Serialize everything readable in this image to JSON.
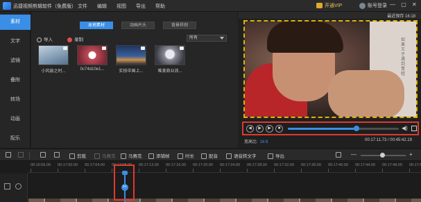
{
  "app": {
    "title": "迅捷视频剪辑软件（免费版）",
    "menu": [
      "文件",
      "编辑",
      "视图",
      "导出",
      "帮助"
    ],
    "vip_label": "开通VIP",
    "login_label": "账号登录",
    "window_controls": "— ▢ ✕"
  },
  "sidebar": {
    "items": [
      {
        "label": "素材",
        "active": true
      },
      {
        "label": "文字"
      },
      {
        "label": "滤镜"
      },
      {
        "label": "叠附"
      },
      {
        "label": "转场"
      },
      {
        "label": "动画"
      },
      {
        "label": "配乐"
      }
    ]
  },
  "media": {
    "tabs": [
      {
        "label": "本地素材",
        "active": true
      },
      {
        "label": "动画片头"
      },
      {
        "label": "背景样例"
      }
    ],
    "import_label": "导入",
    "record_label": "录制",
    "filter_value": "所有",
    "items": [
      {
        "label": "小风扇之时...",
        "color": "#9fb4c7"
      },
      {
        "label": "0c74d10e1...",
        "color": "#b44a55"
      },
      {
        "label": "实拍中国上...",
        "color": "#3c5a8c"
      },
      {
        "label": "唯美商业浪...",
        "color": "#6e6e78"
      }
    ]
  },
  "preview": {
    "autosave": "最近保存 16:18",
    "subtitle_text": "如果王子遇到青蛙",
    "aspect_label": "宽高比:",
    "aspect_value": "16:9",
    "timecode": "00:17:11.73 / 00:45:42.19",
    "progress": 0.62
  },
  "toolbar": {
    "items": [
      {
        "label": "",
        "name": "undo"
      },
      {
        "label": "",
        "name": "redo"
      },
      {
        "label": "",
        "name": "cut"
      },
      {
        "label": "",
        "name": "delete"
      },
      {
        "label": "剪裁",
        "name": "crop"
      },
      {
        "label": "马赛克",
        "name": "mosaic"
      },
      {
        "label": "马赛克",
        "name": "mosaic2"
      },
      {
        "label": "添铺帧",
        "name": "freeze"
      },
      {
        "label": "时长",
        "name": "duration"
      },
      {
        "label": "配音",
        "name": "dub"
      },
      {
        "label": "语音转文字",
        "name": "speech-to-text"
      },
      {
        "label": "导出",
        "name": "export"
      }
    ],
    "zoom_minus": "—",
    "zoom_plus": "+"
  },
  "timeline": {
    "ticks": [
      "00:16:56.00",
      "00:17:00.00",
      "00:17:04.00",
      "00:17:08.00",
      "00:17:12.00",
      "00:17:16.00",
      "00:17:20.00",
      "00:17:24.00",
      "00:17:28.00",
      "00:17:32.00",
      "00:17:36.00",
      "00:17:40.00",
      "00:17:44.00",
      "00:17:48.00",
      "00:17:52.00"
    ]
  }
}
